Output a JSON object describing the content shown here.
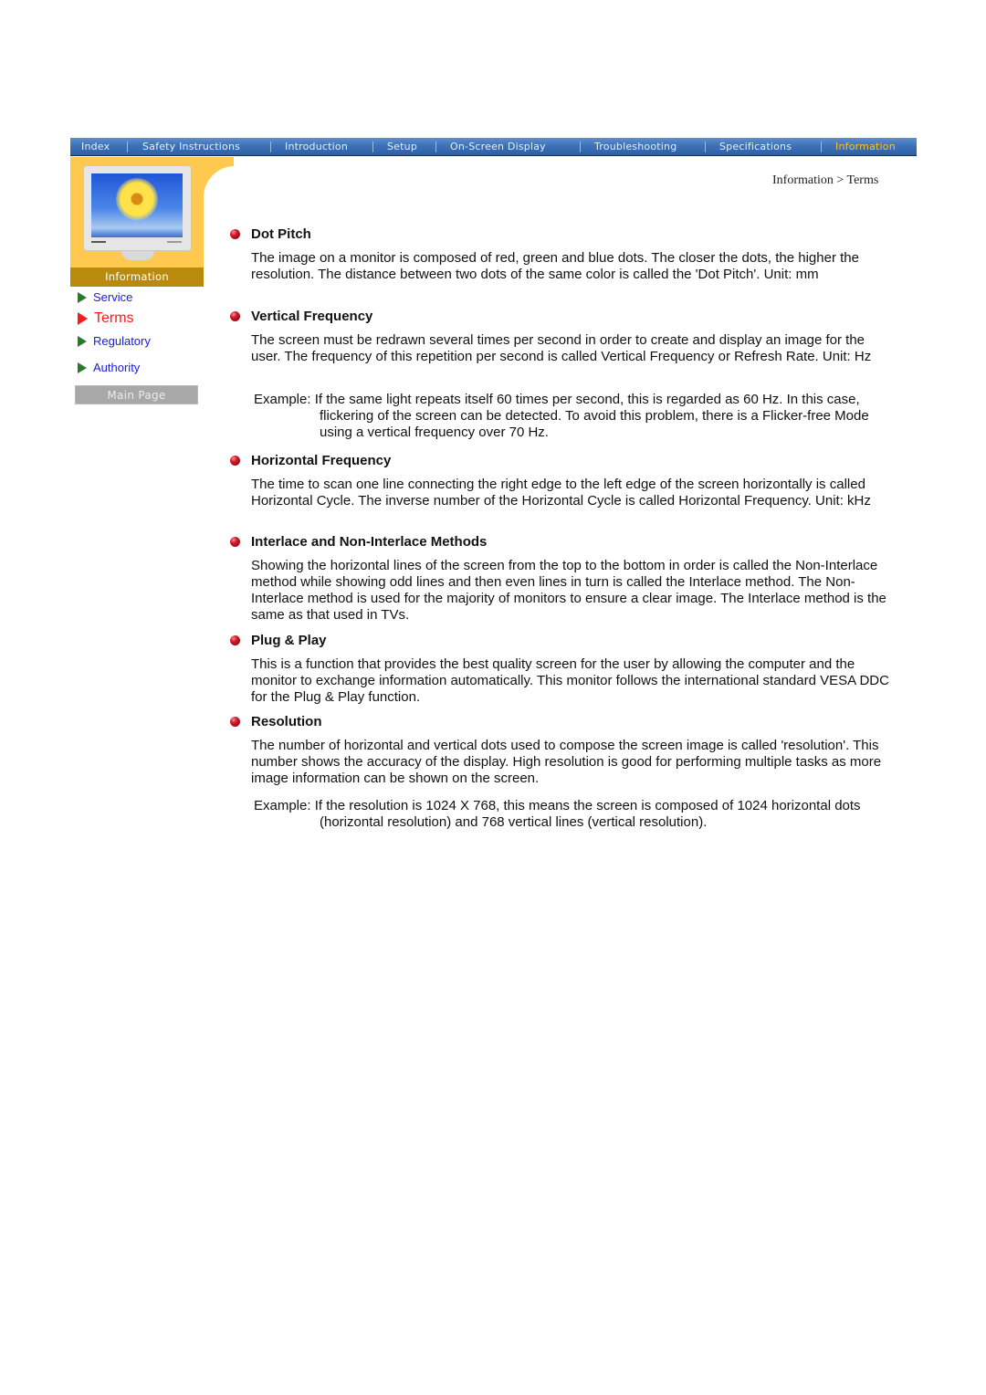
{
  "nav": {
    "items": [
      {
        "label": "Index"
      },
      {
        "label": "Safety Instructions"
      },
      {
        "label": "Introduction"
      },
      {
        "label": "Setup"
      },
      {
        "label": "On-Screen Display"
      },
      {
        "label": "Troubleshooting"
      },
      {
        "label": "Specifications"
      },
      {
        "label": "Information",
        "active": true
      }
    ],
    "active_color": "#ffc325"
  },
  "sidebar": {
    "section_label": "Information",
    "links": [
      {
        "label": "Service"
      },
      {
        "label": "Terms",
        "current": true
      },
      {
        "label": "Regulatory"
      },
      {
        "label": "Authority"
      }
    ],
    "main_page_label": "Main Page"
  },
  "breadcrumb": "Information > Terms",
  "sections": [
    {
      "title": "Dot Pitch",
      "body": "The image on a monitor is composed of red, green and blue dots. The closer the dots, the higher the resolution. The distance between two dots of the same color is called the 'Dot Pitch'. Unit: mm"
    },
    {
      "title": "Vertical Frequency",
      "body": "The screen must be redrawn several times per second in order to create and display an image for the user. The frequency of this repetition per second is called Vertical Frequency or Refresh Rate. Unit: Hz",
      "example": "Example: If the same light repeats itself 60 times per second, this is regarded as 60 Hz. In this case, flickering of the screen can be detected. To avoid this problem, there is a Flicker-free Mode using a vertical frequency over 70 Hz."
    },
    {
      "title": "Horizontal Frequency",
      "body": "The time to scan one line connecting the right edge to the left edge of the screen horizontally is called Horizontal Cycle. The inverse number of the Horizontal Cycle is called Horizontal Frequency. Unit: kHz"
    },
    {
      "title": "Interlace and Non-Interlace Methods",
      "body": "Showing the horizontal lines of the screen from the top to the bottom in order is called the Non-Interlace method while showing odd lines and then even lines in turn is called the Interlace method. The Non-Interlace method is used for the majority of monitors to ensure a clear image. The Interlace method is the same as that used in TVs."
    },
    {
      "title": "Plug & Play",
      "body": "This is a function that provides the best quality screen for the user by allowing the computer and the monitor to exchange information automatically. This monitor follows the international standard VESA DDC for the Plug & Play function."
    },
    {
      "title": "Resolution",
      "body": "The number of horizontal and vertical dots used to compose the screen image is called 'resolution'. This number shows the accuracy of the display. High resolution is good for performing multiple tasks as more image information can be shown on the screen.",
      "example": "Example: If the resolution is 1024 X 768, this means the screen is composed of 1024 horizontal dots (horizontal resolution) and 768 vertical lines (vertical resolution)."
    }
  ]
}
